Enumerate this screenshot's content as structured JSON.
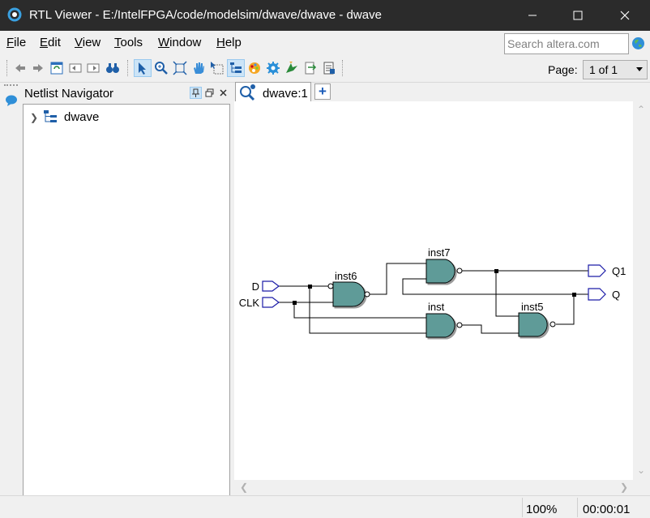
{
  "window": {
    "title": "RTL Viewer - E:/IntelFPGA/code/modelsim/dwave/dwave - dwave"
  },
  "menu": {
    "items": [
      {
        "key": "F",
        "rest": "ile"
      },
      {
        "key": "E",
        "rest": "dit"
      },
      {
        "key": "V",
        "rest": "iew"
      },
      {
        "key": "T",
        "rest": "ools"
      },
      {
        "key": "W",
        "rest": "indow"
      },
      {
        "key": "H",
        "rest": "elp"
      }
    ],
    "search_placeholder": "Search altera.com"
  },
  "toolbar": {
    "page_label": "Page:",
    "page_value": "1 of 1"
  },
  "navigator": {
    "title": "Netlist Navigator",
    "tree": [
      {
        "label": "dwave"
      }
    ]
  },
  "tabs": [
    {
      "label": "dwave:1"
    }
  ],
  "tab_add_label": "+",
  "schematic": {
    "inputs": [
      "D",
      "CLK"
    ],
    "outputs": [
      "Q1",
      "Q"
    ],
    "instances": [
      "inst6",
      "inst7",
      "inst",
      "inst5"
    ]
  },
  "status": {
    "zoom": "100%",
    "time": "00:00:01"
  },
  "colors": {
    "gate_fill": "#5f9b98",
    "port_stroke": "#1c1ca8",
    "titlebar": "#2b2b2b"
  }
}
